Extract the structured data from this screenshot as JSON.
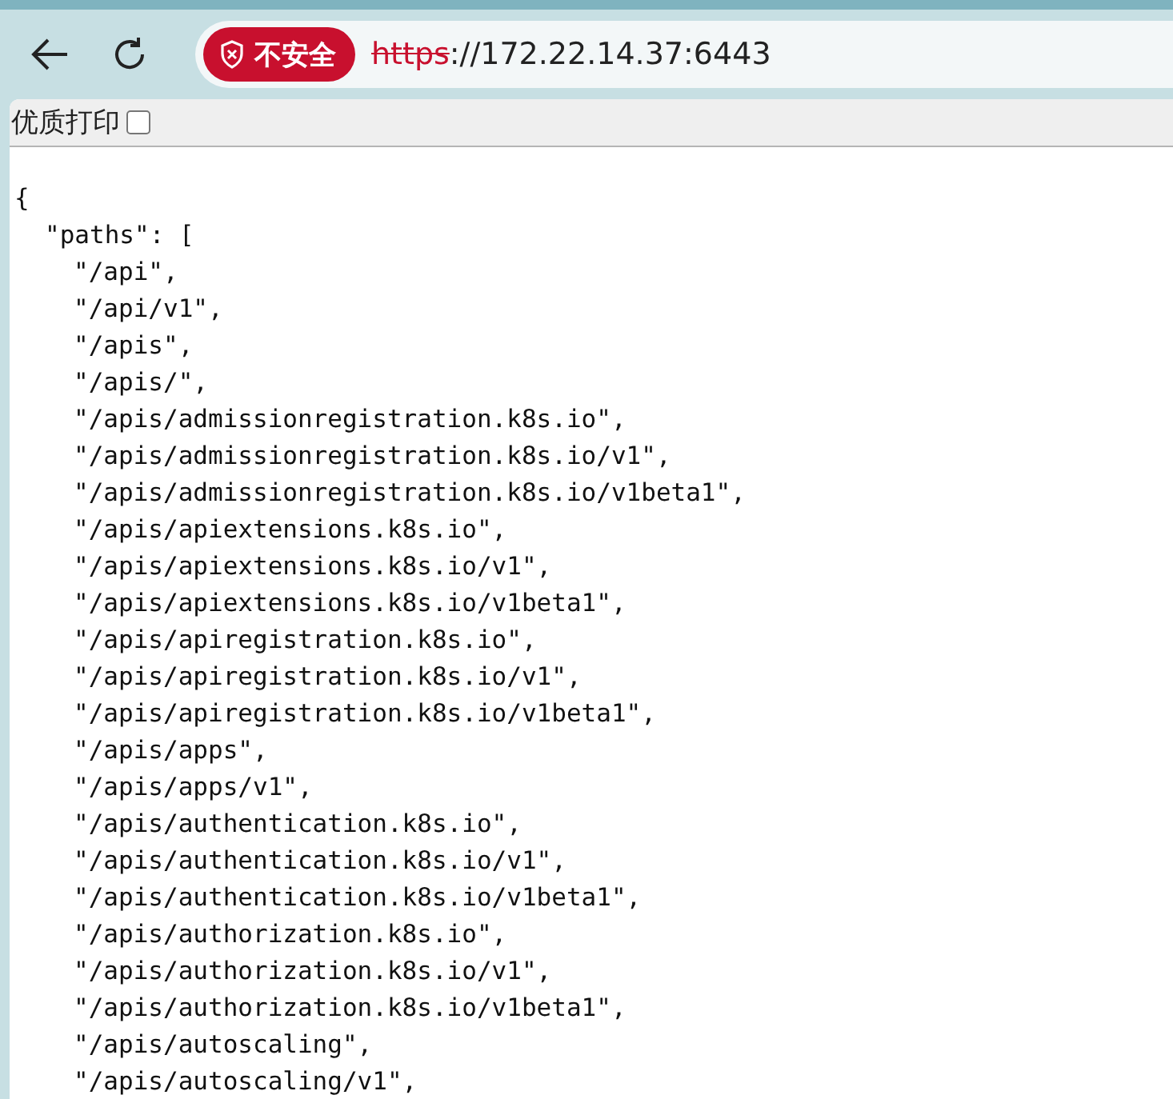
{
  "browser": {
    "security_badge": "不安全",
    "url_scheme": "https",
    "url_rest": "://172.22.14.37:6443"
  },
  "print_bar": {
    "label": "优质打印",
    "checked": false
  },
  "json_text": {
    "open": "{",
    "key_line": "\"paths\": [",
    "paths": [
      "\"/api\",",
      "\"/api/v1\",",
      "\"/apis\",",
      "\"/apis/\",",
      "\"/apis/admissionregistration.k8s.io\",",
      "\"/apis/admissionregistration.k8s.io/v1\",",
      "\"/apis/admissionregistration.k8s.io/v1beta1\",",
      "\"/apis/apiextensions.k8s.io\",",
      "\"/apis/apiextensions.k8s.io/v1\",",
      "\"/apis/apiextensions.k8s.io/v1beta1\",",
      "\"/apis/apiregistration.k8s.io\",",
      "\"/apis/apiregistration.k8s.io/v1\",",
      "\"/apis/apiregistration.k8s.io/v1beta1\",",
      "\"/apis/apps\",",
      "\"/apis/apps/v1\",",
      "\"/apis/authentication.k8s.io\",",
      "\"/apis/authentication.k8s.io/v1\",",
      "\"/apis/authentication.k8s.io/v1beta1\",",
      "\"/apis/authorization.k8s.io\",",
      "\"/apis/authorization.k8s.io/v1\",",
      "\"/apis/authorization.k8s.io/v1beta1\",",
      "\"/apis/autoscaling\",",
      "\"/apis/autoscaling/v1\","
    ]
  }
}
